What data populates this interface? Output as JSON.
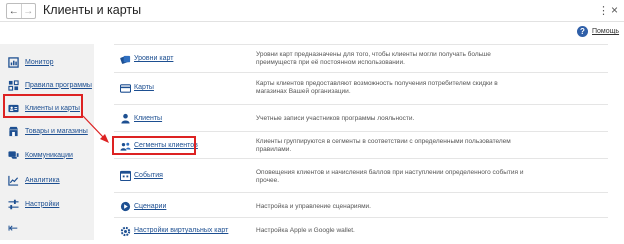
{
  "window": {
    "title": "Клиенты и карты",
    "back_icon": "arrow-left-icon",
    "forward_icon": "arrow-right-icon",
    "more_icon": "vertical-ellipsis-icon",
    "close_icon": "close-icon"
  },
  "help": {
    "label": "Помощь",
    "icon": "question-icon"
  },
  "sidebar": {
    "items": [
      {
        "label": "Монитор",
        "icon": "monitor-icon"
      },
      {
        "label": "Правила программы",
        "icon": "grid-icon"
      },
      {
        "label": "Клиенты и карты",
        "icon": "id-card-icon",
        "selected": true
      },
      {
        "label": "Товары и магазины",
        "icon": "shop-icon"
      },
      {
        "label": "Коммуникации",
        "icon": "chat-icon"
      },
      {
        "label": "Аналитика",
        "icon": "chart-line-icon"
      },
      {
        "label": "Настройки",
        "icon": "sliders-icon"
      }
    ],
    "collapse_icon": "collapse-left-icon"
  },
  "rows": [
    {
      "link": "Уровни карт",
      "icon": "card-levels-icon",
      "desc": "Уровни карт предназначены для того, чтобы клиенты могли получать больше преимуществ при её постоянном использовании."
    },
    {
      "link": "Карты",
      "icon": "credit-card-icon",
      "desc": "Карты клиентов предоставляют возможность получения потребителем скидки в магазинах Вашей организации."
    },
    {
      "link": "Клиенты",
      "icon": "user-icon",
      "desc": "Учетные записи участников программы лояльности."
    },
    {
      "link": "Сегменты клиентов",
      "icon": "users-icon",
      "desc": "Клиенты группируются в сегменты в соответствии с определенными пользователем правилами.",
      "highlighted": true
    },
    {
      "link": "События",
      "icon": "events-icon",
      "desc": "Оповещения клиентов и начисления баллов при наступлении определенного события и прочее."
    },
    {
      "link": "Сценарии",
      "icon": "scenario-icon",
      "desc": "Настройка и управление сценариями."
    },
    {
      "link": "Настройки виртуальных карт",
      "icon": "gear-icon",
      "desc": "Настройка Apple и Google wallet."
    }
  ],
  "colors": {
    "accent": "#1d4f91",
    "highlight": "#dd2222",
    "sidebar_bg": "#f1f1f1"
  }
}
